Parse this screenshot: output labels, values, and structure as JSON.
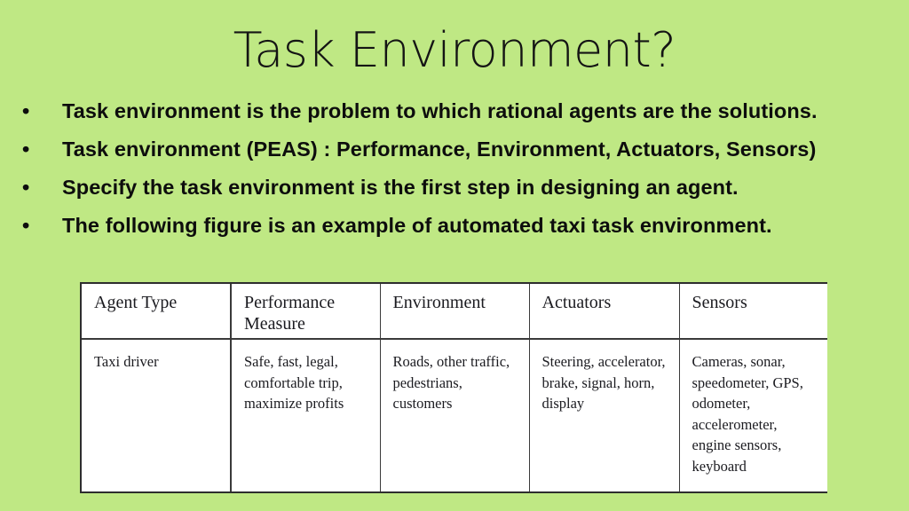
{
  "slide": {
    "title": "Task Environment?",
    "background_color": "#bfe884",
    "text_color": "#0d0d0d"
  },
  "bullets": [
    {
      "marker": "•",
      "text": "Task environment is the problem to which rational agents are the solutions."
    },
    {
      "marker": "•",
      "text": "Task environment (PEAS) : Performance, Environment, Actuators, Sensors)"
    },
    {
      "marker": "•",
      "text": "Specify the task environment is the first step in designing an agent."
    },
    {
      "marker": "•",
      "text": "The following figure is an example of automated taxi task environment."
    }
  ],
  "table": {
    "headers": [
      "Agent Type",
      "Performance Measure",
      "Environment",
      "Actuators",
      "Sensors"
    ],
    "rows": [
      {
        "agent_type": "Taxi driver",
        "performance_measure": "Safe, fast, legal, comfortable trip, maximize profits",
        "environment": "Roads, other traffic, pedestrians, customers",
        "actuators": "Steering, accelerator, brake, signal, horn, display",
        "sensors": "Cameras, sonar, speedometer, GPS, odometer, accelerometer, engine sensors, keyboard"
      }
    ]
  }
}
